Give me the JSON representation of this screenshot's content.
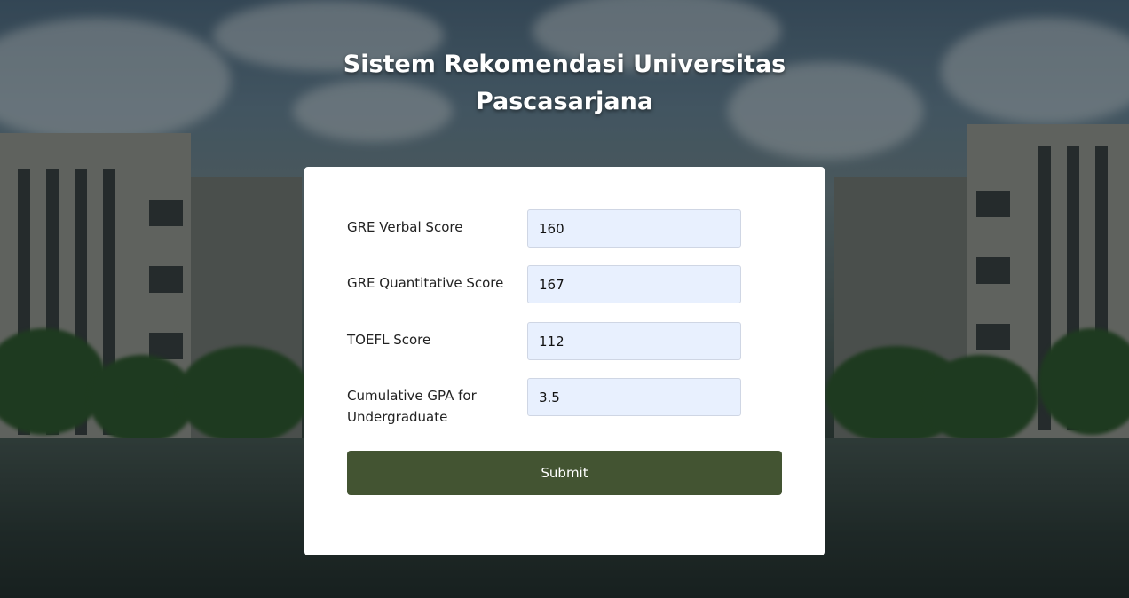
{
  "page": {
    "title_line1": "Sistem Rekomendasi Universitas",
    "title_line2": "Pascasarjana"
  },
  "form": {
    "fields": [
      {
        "label": "GRE Verbal Score",
        "value": "160"
      },
      {
        "label": "GRE Quantitative Score",
        "value": "167"
      },
      {
        "label": "TOEFL Score",
        "value": "112"
      },
      {
        "label": "Cumulative GPA for Undergraduate",
        "value": "3.5"
      }
    ],
    "submit_label": "Submit"
  },
  "colors": {
    "submit_button": "#435432",
    "input_background": "#e8f0fe",
    "card_background": "#ffffff"
  }
}
